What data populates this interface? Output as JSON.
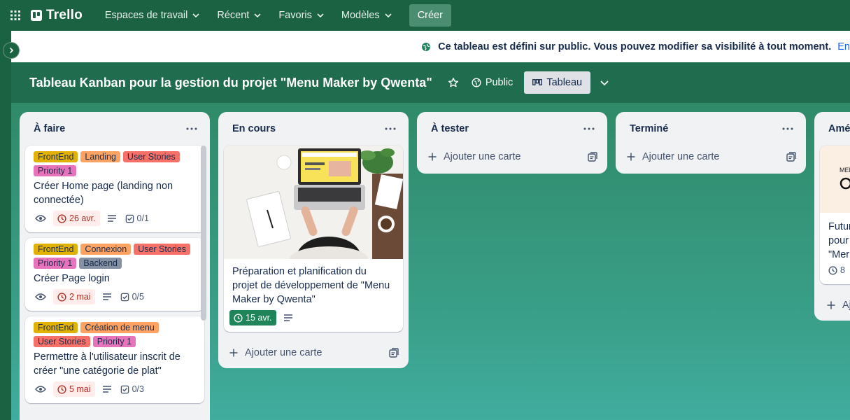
{
  "topbar": {
    "brand": "Trello",
    "nav": [
      "Espaces de travail",
      "Récent",
      "Favoris",
      "Modèles"
    ],
    "create_label": "Créer"
  },
  "banner": {
    "message": "Ce tableau est défini sur public. Vous pouvez modifier sa visibilité à tout moment.",
    "link": "En"
  },
  "board": {
    "title": "Tableau Kanban pour la gestion du projet \"Menu Maker by Qwenta\"",
    "visibility": "Public",
    "view": "Tableau"
  },
  "lists": [
    {
      "title": "À faire",
      "cards": [
        {
          "labels": [
            "FrontEnd",
            "Landing",
            "User Stories",
            "Priority 1"
          ],
          "title": "Créer Home page (landing non connectée)",
          "due": "26 avr.",
          "checklist": "0/1"
        },
        {
          "labels": [
            "FrontEnd",
            "Connexion",
            "User Stories",
            "Priority 1",
            "Backend"
          ],
          "title": "Créer Page login",
          "due": "2 mai",
          "checklist": "0/5"
        },
        {
          "labels": [
            "FrontEnd",
            "Création de menu",
            "User Stories",
            "Priority 1"
          ],
          "title": "Permettre à l'utilisateur inscrit de créer \"une catégorie de plat\"",
          "due": "5 mai",
          "checklist": "0/3"
        }
      ]
    },
    {
      "title": "En cours",
      "cards": [
        {
          "title": "Préparation et planification du projet de développement de \"Menu Maker by Qwenta\"",
          "due": "15 avr."
        }
      ],
      "add_card": "Ajouter une carte"
    },
    {
      "title": "À tester",
      "add_card": "Ajouter une carte"
    },
    {
      "title": "Terminé",
      "add_card": "Ajouter une carte"
    },
    {
      "title": "Amé",
      "cards": [
        {
          "title_lines": [
            "Futur",
            "pour",
            "\"Mer"
          ],
          "count": "8",
          "cover_text": "MEN"
        }
      ],
      "add_card": "Aj"
    }
  ],
  "colors": {
    "topbar": "#1a6241",
    "board": "#2e8a67",
    "due_overdue": "#ae2e24",
    "due_done": "#1f845a"
  }
}
